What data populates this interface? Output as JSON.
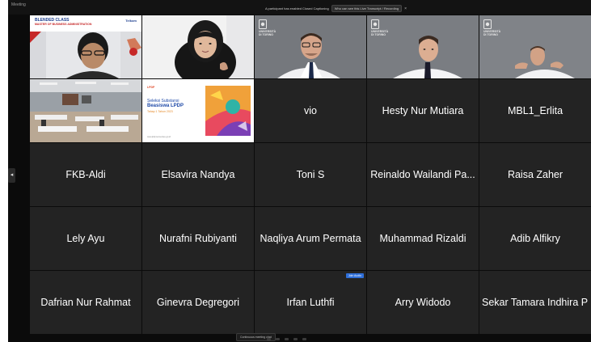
{
  "topbar": {
    "left_label": "Meeting",
    "recording_text": "A participant has enabled Closed Captioning",
    "recording_pill": "Who can see this Live Transcript / Recording",
    "close_glyph": "×"
  },
  "slide_tile": {
    "title": "BLENDED CLASS",
    "subtitle": "MASTER OF BUSINESS ADMINISTRATION",
    "logo": "Telkom"
  },
  "uni_tile": {
    "line1": "UNIVERSITÀ",
    "line2": "DI TORINO"
  },
  "slide2_tile": {
    "top": "LPDP",
    "title1": "Seleksi Substansi",
    "title2": "Beasiswa LPDP",
    "sub": "Tahap 1 Tahun 2023",
    "foot": "www.lpdp.kemenkeu.go.id"
  },
  "participants": [
    {
      "name": "vio"
    },
    {
      "name": "Hesty Nur Mutiara"
    },
    {
      "name": "MBL1_Erlita"
    },
    {
      "name": "FKB-Aldi"
    },
    {
      "name": "Elsavira Nandya"
    },
    {
      "name": "Toni S"
    },
    {
      "name": "Reinaldo Wailandi Pa..."
    },
    {
      "name": "Raisa Zaher"
    },
    {
      "name": "Lely Ayu"
    },
    {
      "name": "Nurafni Rubiyanti"
    },
    {
      "name": "Naqliya Arum Permata"
    },
    {
      "name": "Muhammad Rizaldi"
    },
    {
      "name": "Adib Alfikry"
    },
    {
      "name": "Dafrian Nur Rahmat"
    },
    {
      "name": "Ginevra Degregori"
    },
    {
      "name": "Irfan Luthfi",
      "badge": "Join Audio"
    },
    {
      "name": "Arry Widodo"
    },
    {
      "name": "Sekar Tamara Indhira P"
    }
  ],
  "bottom_tip": "Continuous meeting chat",
  "side_arrow_glyph": "◂",
  "colors": {
    "active_speaker": "#3fae5a",
    "tile_bg": "#232323",
    "badge": "#2f6fd8"
  }
}
